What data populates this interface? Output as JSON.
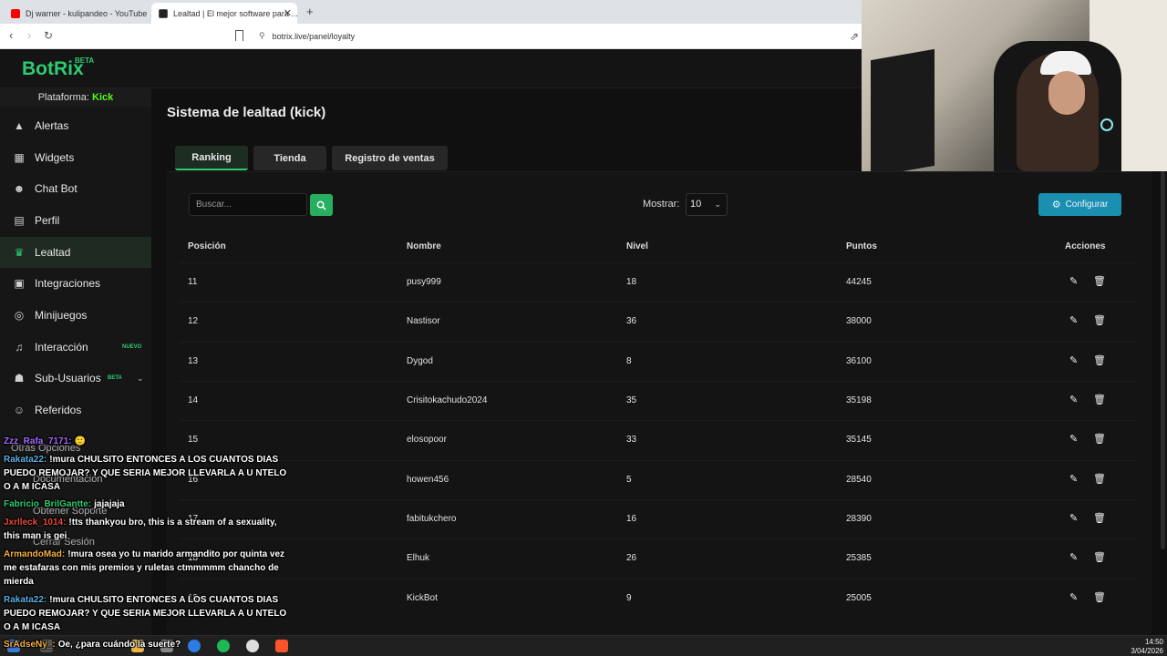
{
  "browser": {
    "tabs": [
      {
        "title": "Dj warner - kulipandeo - YouTube"
      },
      {
        "title": "Lealtad | El mejor software para ..."
      }
    ],
    "url": "botrix.live/panel/loyalty"
  },
  "app": {
    "logo": "BotRix",
    "logo_badge": "BETA"
  },
  "sidebar": {
    "platform_label": "Plataforma:",
    "platform_value": "Kick",
    "items": [
      {
        "label": "Alertas",
        "icon": "warning-icon"
      },
      {
        "label": "Widgets",
        "icon": "grid-icon"
      },
      {
        "label": "Chat Bot",
        "icon": "robot-icon"
      },
      {
        "label": "Perfil",
        "icon": "id-card-icon"
      },
      {
        "label": "Lealtad",
        "icon": "trophy-icon",
        "active": true
      },
      {
        "label": "Integraciones",
        "icon": "plug-icon"
      },
      {
        "label": "Minijuegos",
        "icon": "gamepad-icon"
      },
      {
        "label": "Interacción",
        "icon": "music-icon",
        "badge": "NUEVO"
      },
      {
        "label": "Sub-Usuarios",
        "icon": "users-icon",
        "badge": "BETA"
      },
      {
        "label": "Referidos",
        "icon": "user-icon"
      }
    ],
    "other_title": "Otras Opciones",
    "other_items": [
      "Documentación",
      "Obtener Soporte",
      "Cerrar Sesión"
    ]
  },
  "main": {
    "title": "Sistema de lealtad (kick)",
    "tabs": [
      "Ranking",
      "Tienda",
      "Registro de ventas"
    ],
    "search_placeholder": "Buscar...",
    "show_label": "Mostrar:",
    "show_value": "10",
    "configure_label": "Configurar",
    "columns": [
      "Posición",
      "Nombre",
      "Nivel",
      "Puntos",
      "Acciones"
    ],
    "rows": [
      {
        "pos": "11",
        "name": "pusy999",
        "level": "18",
        "points": "44245"
      },
      {
        "pos": "12",
        "name": "Nastisor",
        "level": "36",
        "points": "38000"
      },
      {
        "pos": "13",
        "name": "Dygod",
        "level": "8",
        "points": "36100"
      },
      {
        "pos": "14",
        "name": "Crisitokachudo2024",
        "level": "35",
        "points": "35198"
      },
      {
        "pos": "15",
        "name": "elosopoor",
        "level": "33",
        "points": "35145"
      },
      {
        "pos": "16",
        "name": "howen456",
        "level": "5",
        "points": "28540"
      },
      {
        "pos": "17",
        "name": "fabitukchero",
        "level": "16",
        "points": "28390"
      },
      {
        "pos": "18",
        "name": "Elhuk",
        "level": "26",
        "points": "25385"
      },
      {
        "pos": "19",
        "name": "KickBot",
        "level": "9",
        "points": "25005"
      }
    ]
  },
  "chat": [
    {
      "user": "Zzz_Rafa_7171:",
      "color": "#a56bff",
      "text": "🙂"
    },
    {
      "user": "Rakata22:",
      "color": "#5dade2",
      "text": "!mura CHULSITO ENTONCES A LOS CUANTOS DIAS PUEDO REMOJAR? Y QUE SERIA MEJOR LLEVARLA A U NTELO O A M ICASA"
    },
    {
      "user": "Fabricio_BrilGantte:",
      "color": "#2ecc71",
      "text": "jajajaja"
    },
    {
      "user": "Jxrlleck_1014:",
      "color": "#e74c3c",
      "text": "!tts thankyou bro, this is a stream of a sexuality, this man is gei"
    },
    {
      "user": "ArmandoMad:",
      "color": "#f5b041",
      "text": "!mura osea yo tu marido armandito por quinta vez me estafaras con mis premios y ruletas ctmmmmm chancho de mierda"
    },
    {
      "user": "Rakata22:",
      "color": "#5dade2",
      "text": "!mura CHULSITO ENTONCES A LOS CUANTOS DIAS PUEDO REMOJAR? Y QUE SERIA MEJOR LLEVARLA A U NTELO O A M ICASA"
    },
    {
      "user": "SrAdseNy_:",
      "color": "#f5b041",
      "text": "Oe, ¿para cuándo la suerte?"
    }
  ],
  "taskbar": {
    "time": "14:50",
    "date": "3/04/2026"
  }
}
